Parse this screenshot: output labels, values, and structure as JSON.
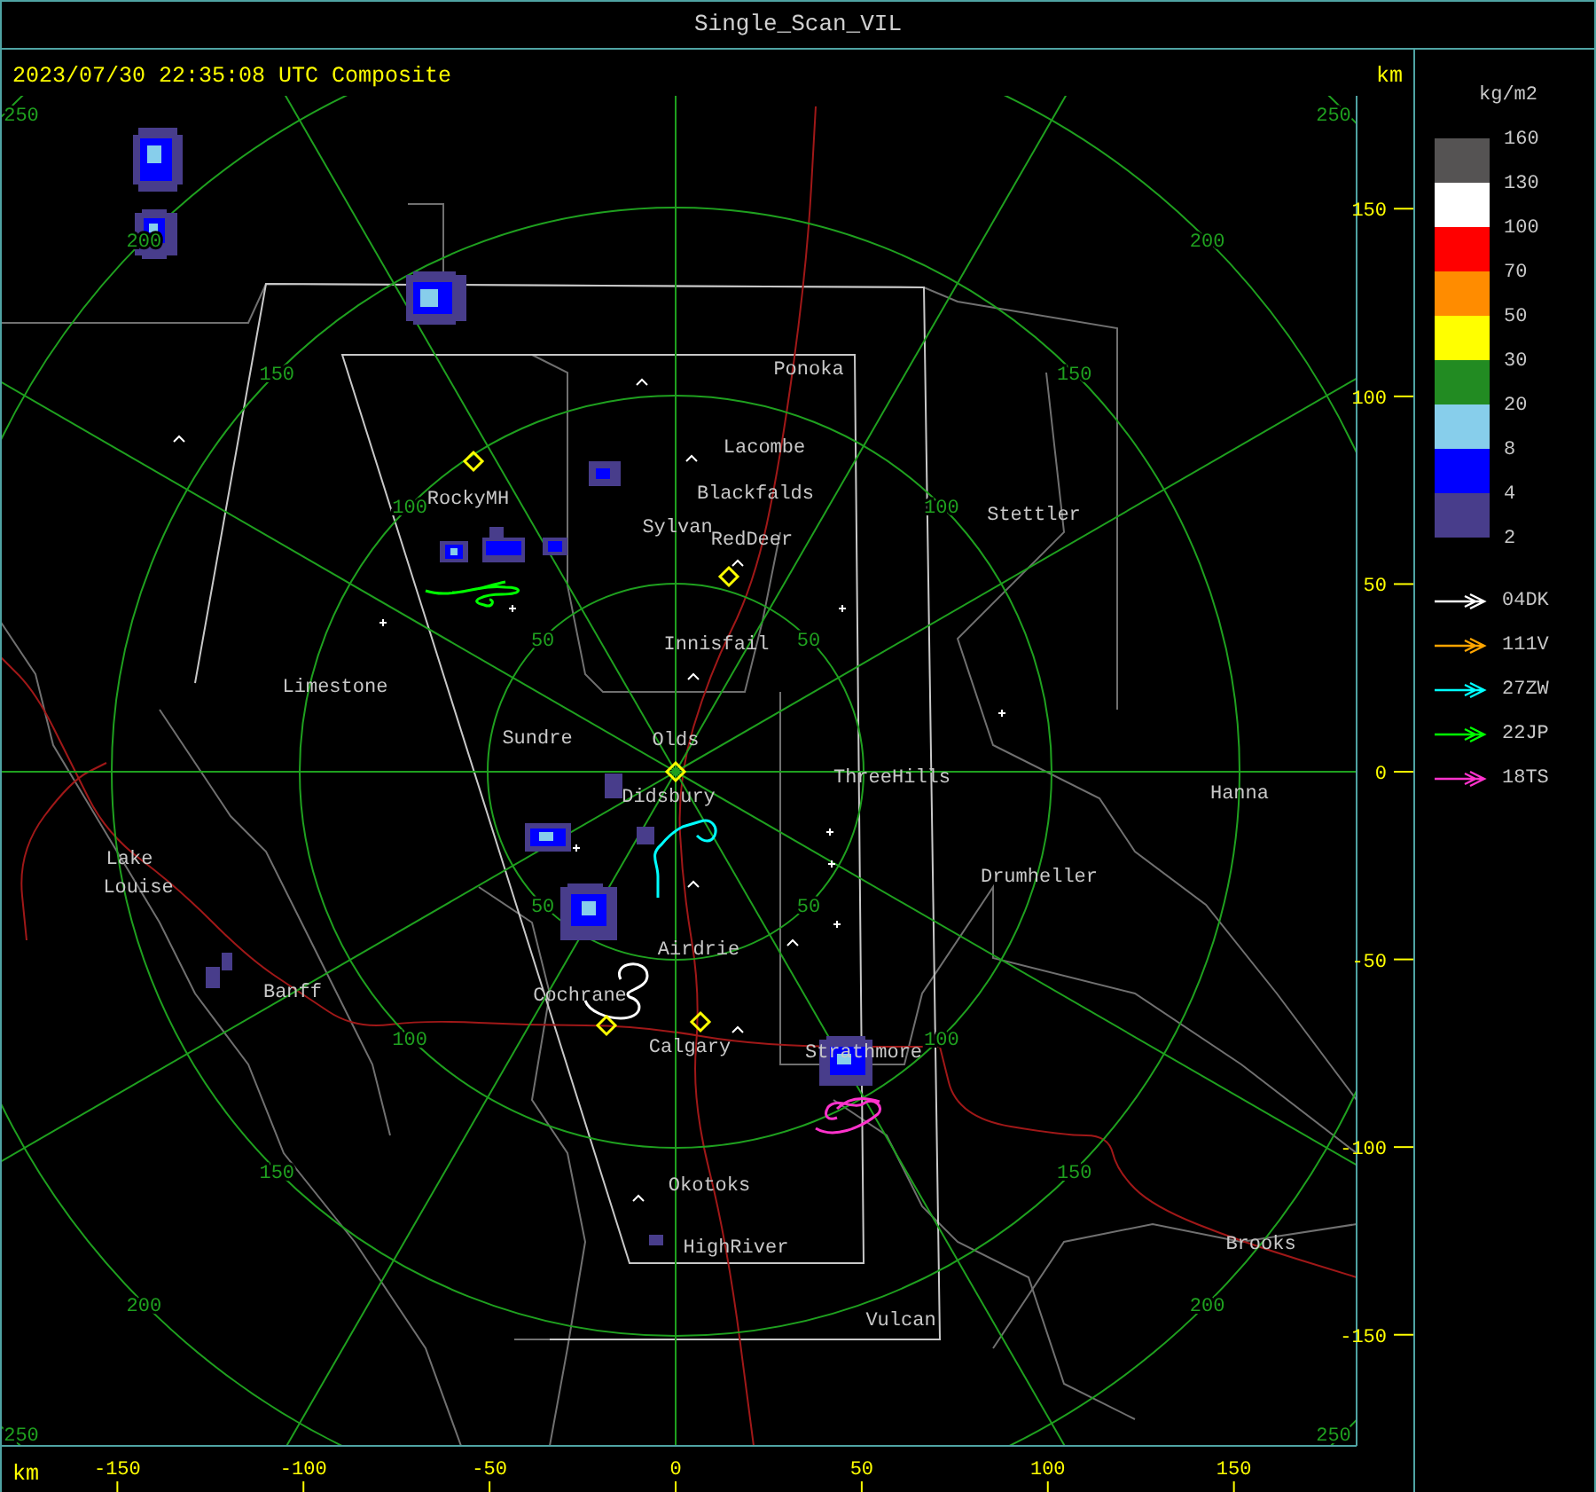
{
  "window": {
    "title": "Single_Scan_VIL"
  },
  "map": {
    "header": "2023/07/30 22:35:08 UTC Composite",
    "unit_top": "km",
    "unit_bottom": "km",
    "x_ticks": [
      "-150",
      "-100",
      "-50",
      "0",
      "50",
      "100",
      "150"
    ],
    "y_ticks": [
      "150",
      "100",
      "50",
      "0",
      "-50",
      "-100",
      "-150"
    ],
    "rings": [
      {
        "labels": [
          "50",
          "50",
          "50",
          "50"
        ]
      },
      {
        "labels": [
          "100",
          "100",
          "100",
          "100"
        ]
      },
      {
        "labels": [
          "150",
          "150",
          "150",
          "150"
        ]
      },
      {
        "labels": [
          "200",
          "200",
          "200",
          "200"
        ]
      },
      {
        "labels": [
          "250",
          "250",
          "250",
          "250"
        ]
      }
    ],
    "places": [
      "Ponoka",
      "Lacombe",
      "Blackfalds",
      "Sylvan",
      "RedDeer",
      "Stettler",
      "RockyMH",
      "Limestone",
      "Innisfail",
      "Sundre",
      "Olds",
      "ThreeHills",
      "Hanna",
      "Didsbury",
      "Drumheller",
      "Lake",
      "Louise",
      "Airdrie",
      "Banff",
      "Cochrane",
      "Calgary",
      "Strathmore",
      "Okotoks",
      "HighRiver",
      "Brooks",
      "Vulcan"
    ]
  },
  "legend": {
    "unit": "kg/m2",
    "levels": [
      {
        "color": "#555353",
        "label": "160"
      },
      {
        "color": "#ffffff",
        "label": "130"
      },
      {
        "color": "#ff0000",
        "label": "100"
      },
      {
        "color": "#ff8c00",
        "label": "70"
      },
      {
        "color": "#ffff00",
        "label": "50"
      },
      {
        "color": "#228b22",
        "label": "30"
      },
      {
        "color": "#87ceeb",
        "label": "20"
      },
      {
        "color": "#0000ff",
        "label": "8"
      },
      {
        "color": "#483d8b",
        "label": "4"
      }
    ],
    "bottom_label": "2",
    "tracks": [
      {
        "name": "04DK",
        "color": "#ffffff"
      },
      {
        "name": "111V",
        "color": "#ffa500"
      },
      {
        "name": "27ZW",
        "color": "#00ffff"
      },
      {
        "name": "22JP",
        "color": "#00ff00"
      },
      {
        "name": "18TS",
        "color": "#ff33cc"
      }
    ]
  }
}
